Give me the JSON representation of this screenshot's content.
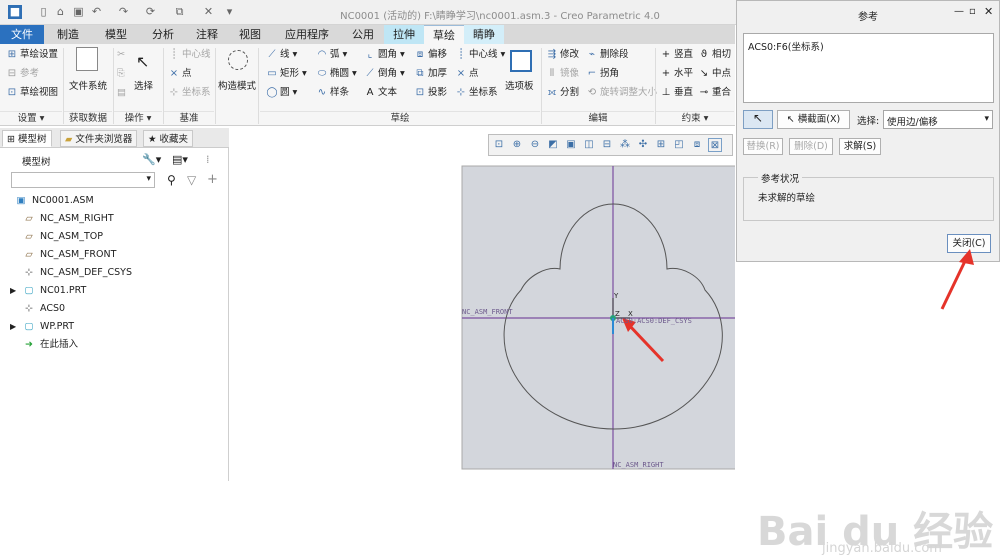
{
  "window": {
    "title": "NC0001 (活动的) F:\\睛睁学习\\nc0001.asm.3 - Creo Parametric 4.0",
    "quick_access": [
      "save-icon",
      "open-icon",
      "undo-icon",
      "redo-icon",
      "regenerate-icon",
      "window-icon",
      "close-window-icon",
      "customize-icon"
    ]
  },
  "tabs": [
    {
      "label": "文件",
      "kind": "file"
    },
    {
      "label": "制造",
      "kind": "normal"
    },
    {
      "label": "模型",
      "kind": "normal"
    },
    {
      "label": "分析",
      "kind": "normal"
    },
    {
      "label": "注释",
      "kind": "normal"
    },
    {
      "label": "视图",
      "kind": "normal"
    },
    {
      "label": "应用程序",
      "kind": "normal"
    },
    {
      "label": "公用",
      "kind": "normal"
    },
    {
      "label": "拉伸",
      "kind": "ctx"
    },
    {
      "label": "草绘",
      "kind": "active"
    },
    {
      "label": "睛睁",
      "kind": "ctx2"
    }
  ],
  "ribbon": {
    "setup": {
      "items": [
        "草绘设置",
        "参考",
        "草绘视图"
      ],
      "group": "设置"
    },
    "getdata": {
      "items": [
        "文件系统"
      ],
      "group": "获取数据"
    },
    "ops": {
      "items": [
        "选择"
      ],
      "group": "操作"
    },
    "datum": {
      "items": [
        "中心线",
        "点",
        "坐标系"
      ],
      "group": "基准"
    },
    "construct": {
      "label": "构造模式"
    },
    "sketch": {
      "col1": [
        "线",
        "矩形",
        "圆"
      ],
      "col2": [
        "弧",
        "椭圆",
        "样条"
      ],
      "col3": [
        "圆角",
        "倒角",
        "文本"
      ],
      "col4": [
        "偏移",
        "加厚",
        "投影"
      ],
      "col5": [
        "中心线",
        "点",
        "坐标系"
      ],
      "palette": "选项板",
      "group": "草绘"
    },
    "edit": {
      "items": [
        "修改",
        "删除段",
        "镜像",
        "拐角",
        "分割",
        "旋转调整大小"
      ],
      "group": "编辑"
    },
    "constrain": {
      "items": [
        "竖直",
        "相切",
        "水平",
        "中点",
        "垂直",
        "重合"
      ],
      "group": "约束"
    }
  },
  "navigator": {
    "tabs": [
      "模型树",
      "文件夹浏览器",
      "收藏夹"
    ],
    "tree_label": "模型树",
    "search_placeholder": "",
    "items": [
      {
        "label": "NC0001.ASM",
        "icon": "assembly-icon",
        "indent": 0,
        "expand": false
      },
      {
        "label": "NC_ASM_RIGHT",
        "icon": "datum-plane-icon",
        "indent": 1,
        "expand": false
      },
      {
        "label": "NC_ASM_TOP",
        "icon": "datum-plane-icon",
        "indent": 1,
        "expand": false
      },
      {
        "label": "NC_ASM_FRONT",
        "icon": "datum-plane-icon",
        "indent": 1,
        "expand": false
      },
      {
        "label": "NC_ASM_DEF_CSYS",
        "icon": "csys-icon",
        "indent": 1,
        "expand": false
      },
      {
        "label": "NC01.PRT",
        "icon": "part-icon",
        "indent": 1,
        "expand": true
      },
      {
        "label": "ACS0",
        "icon": "csys-icon",
        "indent": 1,
        "expand": false
      },
      {
        "label": "WP.PRT",
        "icon": "part-icon",
        "indent": 1,
        "expand": true
      },
      {
        "label": "在此插入",
        "icon": "insert-here-icon",
        "indent": 1,
        "expand": false
      }
    ]
  },
  "graphics": {
    "labels": {
      "vertical_datum_bottom": "NC_ASM_RIGHT",
      "horizontal_datum_left": "NC_ASM_FRONT",
      "csys_label": "ACS0:ACS0:DEF_CSYS",
      "axis_y": "Y",
      "axis_x": "X",
      "axis_z": "Z"
    },
    "colors": {
      "sketch_bg": "#d3d6dc",
      "datum": "#7b4fa0",
      "curve": "#555555",
      "arrow": "#e5332a"
    }
  },
  "dialog": {
    "title": "参考",
    "reference_entry": "ACS0:F6(坐标系)",
    "pick_label": "",
    "xsec_button": "横截面(X)",
    "select_label": "选择:",
    "select_value": "使用边/偏移",
    "replace_button": "替换(R)",
    "delete_button": "删除(D)",
    "solve_button": "求解(S)",
    "status_group": "参考状况",
    "status_text": "未求解的草绘",
    "close_button": "关闭(C)"
  },
  "watermark": {
    "brand": "Bai du 经验",
    "url": "jingyan.baidu.com"
  }
}
